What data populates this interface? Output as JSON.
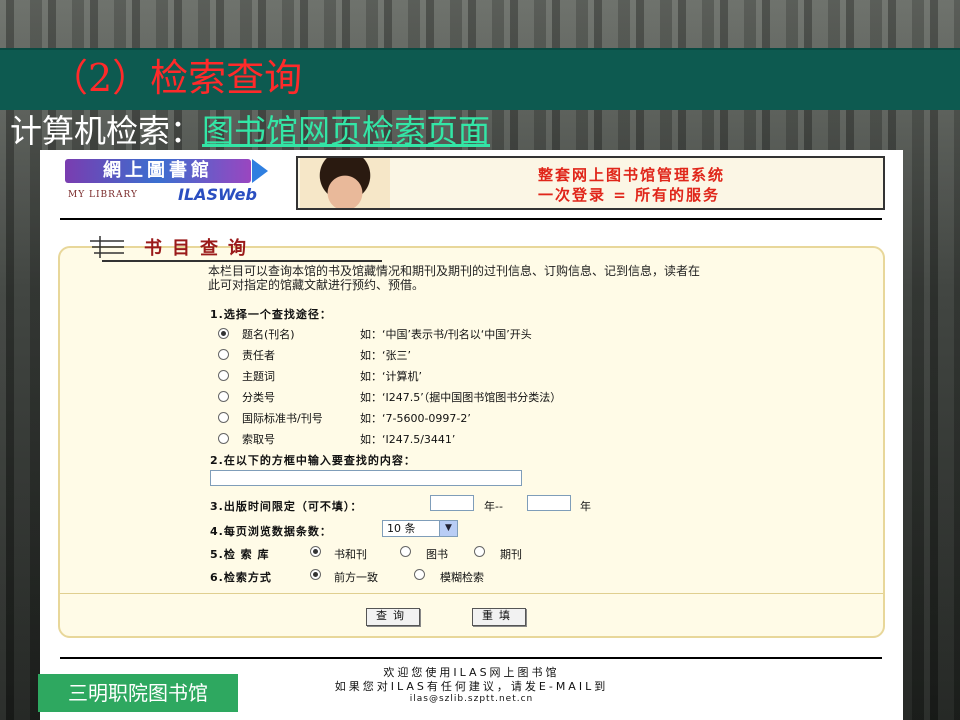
{
  "slide": {
    "title": "（2）检索查询",
    "subtitle_prefix": "计算机检索：",
    "subtitle_link": "图书馆网页检索页面",
    "library_tag": "三明职院图书馆"
  },
  "header": {
    "logo_cn": "網上圖書館",
    "logo_en1": "MY LIBRARY",
    "logo_en2": "ILASWeb",
    "banner_line1": "整套网上图书馆管理系统",
    "banner_line2": "一次登录  =  所有的服务"
  },
  "form": {
    "section_title": "书目查询",
    "intro": "本栏目可以查询本馆的书及馆藏情况和期刊及期刊的过刊信息、订购信息、记到信息，读者在此可对指定的馆藏文献进行预约、预借。",
    "step1": "1.选择一个查找途径：",
    "options": [
      {
        "label": "题名(刊名)",
        "example": "如：‘中国’表示书/刊名以‘中国’开头",
        "checked": true
      },
      {
        "label": "责任者",
        "example": "如：‘张三’",
        "checked": false
      },
      {
        "label": "主题词",
        "example": "如：‘计算机’",
        "checked": false
      },
      {
        "label": "分类号",
        "example": "如：‘I247.5’（据中国图书馆图书分类法）",
        "checked": false
      },
      {
        "label": "国际标准书/刊号",
        "example": "如：‘7-5600-0997-2’",
        "checked": false
      },
      {
        "label": "索取号",
        "example": "如：‘I247.5/3441’",
        "checked": false
      }
    ],
    "step2": "2.在以下的方框中输入要查找的内容：",
    "search_value": "",
    "step3": "3.出版时间限定（可不填）：",
    "year_sep": "年--",
    "year_end": "年",
    "step4": "4.每页浏览数据条数：",
    "per_page": "10 条",
    "step5": "5.检 索 库",
    "db_options": [
      {
        "label": "书和刊",
        "checked": true
      },
      {
        "label": "图书",
        "checked": false
      },
      {
        "label": "期刊",
        "checked": false
      }
    ],
    "step6": "6.检索方式",
    "mode_options": [
      {
        "label": "前方一致",
        "checked": true
      },
      {
        "label": "模糊检索",
        "checked": false
      }
    ],
    "query_btn": "查询",
    "reset_btn": "重填"
  },
  "footer": {
    "line1": "欢迎您使用ILAS网上图书馆",
    "line2": "如果您对ILAS有任何建议，请发E-MAIL到",
    "email": "ilas@szlib.szptt.net.cn"
  },
  "colors": {
    "title_bar": "#0d5a50",
    "title_text": "#ff2a2a",
    "link": "#33e6a6",
    "tag_bg": "#2ea860",
    "banner_text": "#e0261a"
  }
}
